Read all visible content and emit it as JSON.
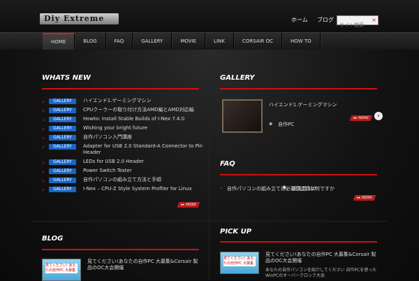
{
  "header": {
    "logo_text": "Diy Extreme",
    "links": [
      "ホーム",
      "ブログ"
    ],
    "search_placeholder": "サイト検索",
    "search_clear": "×"
  },
  "nav": {
    "items": [
      "HOME",
      "BLOG",
      "FAQ",
      "GALLERY",
      "MOVIE",
      "LINK",
      "CORSAIR OC",
      "HOW TO"
    ],
    "active": "HOME"
  },
  "whats_new": {
    "title": "WHATS NEW",
    "more_label": "▸▸ MORE",
    "items": [
      {
        "tag": "GALLERY",
        "text": "ハイエンド1.ゲーミングマシン"
      },
      {
        "tag": "GALLERY",
        "text": "CPUクーラーの取り付け方法AMD編とAMD対応編"
      },
      {
        "tag": "GALLERY",
        "text": "Howto: Install Stable Builds of I-Nex 7.4.0"
      },
      {
        "tag": "GALLERY",
        "text": "Wishing your bright future"
      },
      {
        "tag": "GALLERY",
        "text": "自作パソコン入門講座"
      },
      {
        "tag": "GALLERY",
        "text": "Adapter for USB 2.0 Standard-A Connector to Pin Header"
      },
      {
        "tag": "GALLERY",
        "text": "LEDs for USB 2.0 Header"
      },
      {
        "tag": "GALLERY",
        "text": "Power Switch Tester"
      },
      {
        "tag": "GALLERY",
        "text": "自作パソコンの組み立て方法と手順"
      },
      {
        "tag": "GALLERY",
        "text": "I-Nex – CPU-Z Style System Profiler for Linux"
      }
    ]
  },
  "gallery": {
    "title": "GALLERY",
    "item_title": "ハイエンド1.ゲーミングマシン",
    "category": "自作PC",
    "more_label": "▸▸ MORE",
    "next": "›"
  },
  "faq": {
    "title": "FAQ",
    "item_text": "自作パソコンの組み立てに必要な工具は何ですか",
    "views": "閲覧数317",
    "more_label": "▸▸ MORE"
  },
  "blog": {
    "title": "BLOG",
    "item_title": "見てください!あなたの自作PC 大募集&Corsair 製品のOC大会開催",
    "thumb_caption": "見てください! あなたの自作PC 大募集"
  },
  "pickup": {
    "title": "PICK UP",
    "item_title": "見てください!あなたの自作PC 大募集&Corsair 製品のOC大会開催",
    "item_sub": "あなたの自作パソコンを紹介してください 自作PCを使ったWinPCのオーバークロック大会",
    "thumb_caption": "見てください! あなたの自作PC 大募集"
  }
}
